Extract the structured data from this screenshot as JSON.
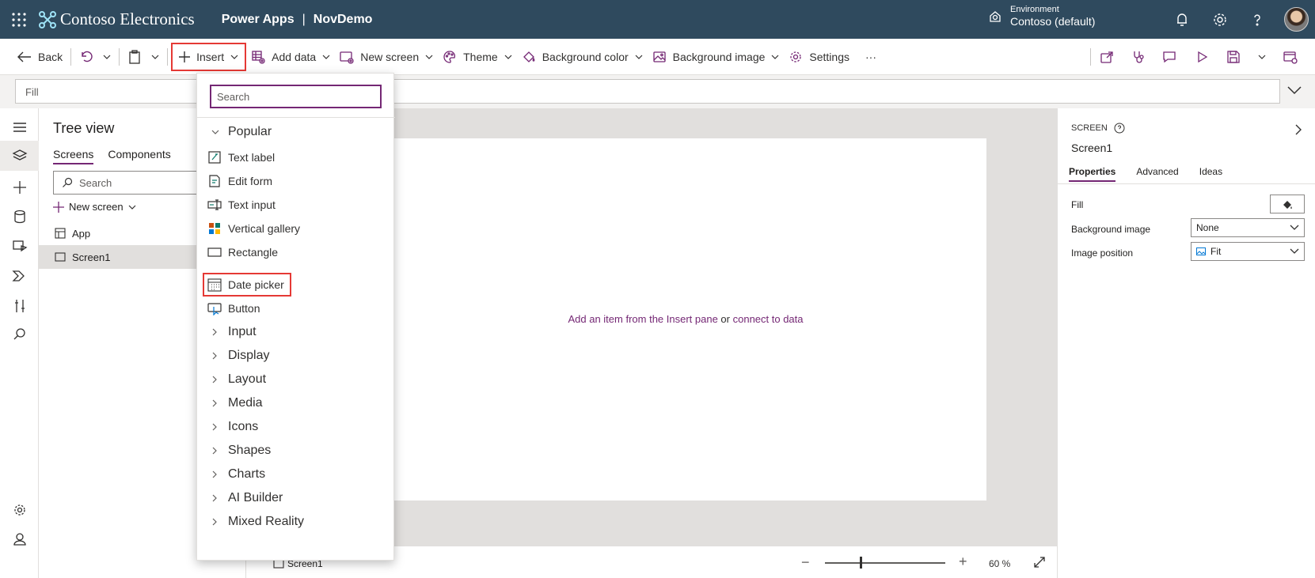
{
  "header": {
    "brand": "Contoso Electronics",
    "app_name": "Power Apps",
    "separator": "|",
    "file_name": "NovDemo",
    "environment_label": "Environment",
    "environment_value": "Contoso (default)",
    "colors": {
      "header_bg": "#2f4a5e",
      "accent": "#742774",
      "highlight": "#e53935"
    }
  },
  "commandbar": {
    "back": "Back",
    "insert": "Insert",
    "add_data": "Add data",
    "new_screen": "New screen",
    "theme": "Theme",
    "background_color": "Background color",
    "background_image": "Background image",
    "settings": "Settings",
    "more": "···"
  },
  "formulabar": {
    "property": "Fill"
  },
  "tree": {
    "title": "Tree view",
    "tabs": [
      "Screens",
      "Components"
    ],
    "search_placeholder": "Search",
    "new_screen": "New screen",
    "items": [
      {
        "label": "App"
      },
      {
        "label": "Screen1"
      }
    ]
  },
  "canvas": {
    "hint_link1": "Add an item from the Insert pane",
    "hint_mid": " or ",
    "hint_link2": "connect to data",
    "screen_crumb": "Screen1",
    "zoom_minus": "−",
    "zoom_plus": "+",
    "zoom_value": "60  %",
    "zoom_level_percent": 60
  },
  "rightpane": {
    "kind": "SCREEN",
    "name": "Screen1",
    "tabs": [
      "Properties",
      "Advanced",
      "Ideas"
    ],
    "props": [
      {
        "label": "Fill"
      },
      {
        "label": "Background image",
        "value": "None"
      },
      {
        "label": "Image position",
        "value": "Fit"
      }
    ]
  },
  "insert_menu": {
    "search_placeholder": "Search",
    "popular": "Popular",
    "popular_items": [
      "Text label",
      "Edit form",
      "Text input",
      "Vertical gallery",
      "Rectangle",
      "Date picker",
      "Button"
    ],
    "categories": [
      "Input",
      "Display",
      "Layout",
      "Media",
      "Icons",
      "Shapes",
      "Charts",
      "AI Builder",
      "Mixed Reality"
    ]
  }
}
